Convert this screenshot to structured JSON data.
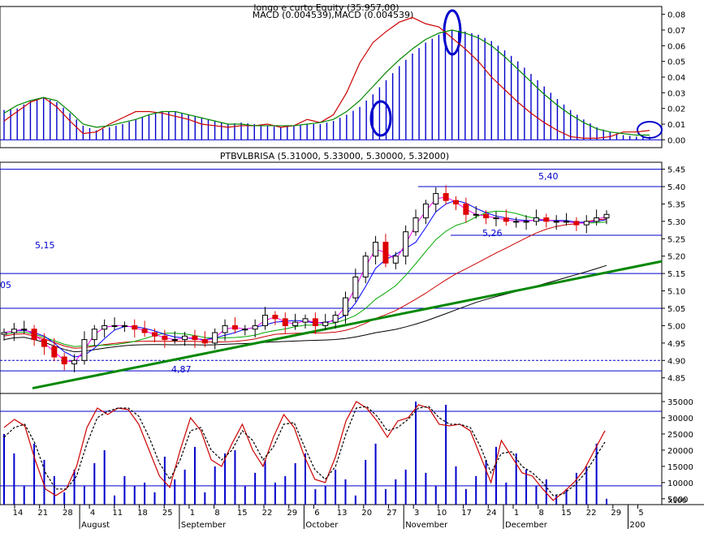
{
  "chart_data": [
    {
      "type": "line",
      "panel": "macd",
      "title_lines": [
        "longo e curto Equity (35.957,00)",
        "MACD (0.004539),MACD (0.004539)"
      ],
      "ylim": [
        -0.005,
        0.085
      ],
      "y_ticks": [
        "0.00",
        "0.01",
        "0.02",
        "0.03",
        "0.04",
        "0.05",
        "0.06",
        "0.07",
        "0.08"
      ],
      "y_tick_values": [
        0,
        0.01,
        0.02,
        0.03,
        0.04,
        0.05,
        0.06,
        0.07,
        0.08
      ],
      "series": [
        {
          "values": [
            0.019,
            0.02,
            0.025,
            0.027,
            0.024,
            0.017,
            0.009,
            0.006,
            0.008,
            0.01,
            0.013,
            0.016,
            0.018,
            0.018,
            0.016,
            0.014,
            0.012,
            0.01,
            0.011,
            0.01,
            0.009,
            0.008,
            0.009,
            0.01,
            0.01,
            0.012,
            0.016,
            0.021,
            0.029,
            0.038,
            0.047,
            0.055,
            0.062,
            0.067,
            0.07,
            0.069,
            0.067,
            0.063,
            0.057,
            0.05,
            0.042,
            0.034,
            0.026,
            0.019,
            0.013,
            0.008,
            0.005,
            0.003,
            0.002,
            0.002
          ],
          "color": "#0000cc",
          "style": "histogram"
        },
        {
          "values": [
            0.012,
            0.018,
            0.024,
            0.027,
            0.021,
            0.012,
            0.004,
            0.005,
            0.01,
            0.014,
            0.018,
            0.018,
            0.017,
            0.015,
            0.013,
            0.01,
            0.009,
            0.008,
            0.009,
            0.009,
            0.01,
            0.008,
            0.009,
            0.013,
            0.011,
            0.016,
            0.03,
            0.049,
            0.062,
            0.069,
            0.075,
            0.078,
            0.074,
            0.072,
            0.065,
            0.058,
            0.05,
            0.04,
            0.032,
            0.024,
            0.017,
            0.011,
            0.006,
            0.002,
            0.001,
            0.001,
            0.002,
            0.005,
            0.005,
            0.006
          ],
          "color": "#cc0000",
          "style": "line"
        },
        {
          "values": [
            0.017,
            0.022,
            0.025,
            0.027,
            0.025,
            0.018,
            0.01,
            0.008,
            0.009,
            0.011,
            0.013,
            0.016,
            0.018,
            0.018,
            0.016,
            0.014,
            0.012,
            0.01,
            0.01,
            0.009,
            0.009,
            0.009,
            0.009,
            0.01,
            0.011,
            0.013,
            0.018,
            0.025,
            0.034,
            0.043,
            0.051,
            0.058,
            0.064,
            0.068,
            0.07,
            0.068,
            0.065,
            0.06,
            0.053,
            0.045,
            0.037,
            0.029,
            0.022,
            0.016,
            0.011,
            0.007,
            0.005,
            0.004,
            0.003,
            0.003
          ],
          "color": "#008800",
          "style": "line"
        }
      ]
    },
    {
      "type": "candlestick",
      "panel": "price",
      "title": "PTBVLBRISA (5.31000, 5.33000, 5.30000, 5.32000)",
      "ylim": [
        4.805,
        5.47
      ],
      "y_ticks": [
        "4.85",
        "4.90",
        "4.95",
        "5.00",
        "5.05",
        "5.10",
        "5.15",
        "5.20",
        "5.25",
        "5.30",
        "5.35",
        "5.40",
        "5.45"
      ],
      "y_tick_values": [
        4.85,
        4.9,
        4.95,
        5.0,
        5.05,
        5.1,
        5.15,
        5.2,
        5.25,
        5.3,
        5.35,
        5.4,
        5.45
      ],
      "closes": [
        4.98,
        4.99,
        4.99,
        4.96,
        4.94,
        4.91,
        4.89,
        4.9,
        4.96,
        4.99,
        5.0,
        5.0,
        5.0,
        4.99,
        4.98,
        4.97,
        4.96,
        4.96,
        4.97,
        4.96,
        4.95,
        4.98,
        5.0,
        4.99,
        4.99,
        5.0,
        5.03,
        5.02,
        5.0,
        5.01,
        5.02,
        5.0,
        5.01,
        5.03,
        5.08,
        5.14,
        5.2,
        5.24,
        5.18,
        5.2,
        5.27,
        5.31,
        5.35,
        5.38,
        5.36,
        5.35,
        5.32,
        5.32,
        5.31,
        5.31,
        5.3,
        5.3,
        5.3,
        5.31,
        5.3,
        5.3,
        5.3,
        5.29,
        5.3,
        5.31,
        5.32
      ],
      "volume": [
        25000,
        19000,
        9000,
        22000,
        17000,
        12000,
        7000,
        14000,
        9000,
        16000,
        20000,
        6000,
        12000,
        9000,
        10000,
        7000,
        18000,
        11000,
        14000,
        21000,
        7000,
        15000,
        19000,
        20000,
        9000,
        13000,
        17000,
        10000,
        12000,
        16000,
        19000,
        8000,
        9000,
        14000,
        11000,
        6000,
        17000,
        22000,
        8000,
        11000,
        14000,
        35000,
        13000,
        9000,
        34000,
        15000,
        8000,
        12000,
        17000,
        21000,
        10000,
        19000,
        14000,
        9000,
        11000,
        6000,
        8000,
        13000,
        15000,
        22000,
        5000
      ],
      "annotations": [
        "5,40",
        "5,26",
        "5,15",
        "05",
        "4,87"
      ]
    },
    {
      "type": "line",
      "panel": "stochastic",
      "ylim": [
        3200,
        37500
      ],
      "y_ticks": [
        "5000",
        "10000",
        "15000",
        "20000",
        "25000",
        "30000",
        "35000"
      ],
      "y_tick_values": [
        5000,
        10000,
        15000,
        20000,
        25000,
        30000,
        35000
      ],
      "series": [
        {
          "values": [
            27000,
            29500,
            27500,
            17000,
            8000,
            6000,
            8000,
            15000,
            27000,
            33000,
            31000,
            33000,
            32500,
            28000,
            20000,
            12000,
            8500,
            20000,
            30000,
            26000,
            17000,
            15000,
            22000,
            28000,
            20000,
            15000,
            24000,
            31000,
            27000,
            18000,
            11000,
            10000,
            18000,
            29000,
            35000,
            33000,
            29000,
            24000,
            29000,
            30000,
            34000,
            33000,
            28000,
            27500,
            28000,
            26000,
            18000,
            10000,
            23000,
            18000,
            13000,
            12000,
            8000,
            4500,
            7000,
            10000,
            14000,
            20000,
            26000
          ],
          "color": "#cc0000",
          "dash": false
        },
        {
          "values": [
            24000,
            27000,
            28000,
            22000,
            13000,
            8000,
            8000,
            12000,
            22000,
            30000,
            32000,
            33000,
            33000,
            30500,
            24000,
            16000,
            11000,
            17000,
            26000,
            27000,
            20000,
            17000,
            20000,
            26000,
            23000,
            17000,
            21000,
            28000,
            28500,
            21000,
            14000,
            11000,
            15000,
            25000,
            33000,
            33500,
            30500,
            26000,
            27000,
            29500,
            33000,
            33500,
            30000,
            28000,
            28000,
            27000,
            21000,
            13000,
            19000,
            19500,
            15000,
            13000,
            10000,
            6000,
            6500,
            9000,
            12500,
            17500,
            22500
          ],
          "color": "#000000",
          "dash": true
        }
      ]
    }
  ],
  "x_axis": {
    "day_labels": [
      "14",
      "21",
      "28",
      "4",
      "11",
      "18",
      "25",
      "1",
      "8",
      "15",
      "22",
      "29",
      "6",
      "13",
      "20",
      "27",
      "3",
      "10",
      "17",
      "24",
      "1",
      "8",
      "15",
      "22",
      "29",
      "5"
    ],
    "month_labels": [
      "August",
      "September",
      "October",
      "November",
      "December",
      "200"
    ],
    "multiplier_label": "x100"
  }
}
